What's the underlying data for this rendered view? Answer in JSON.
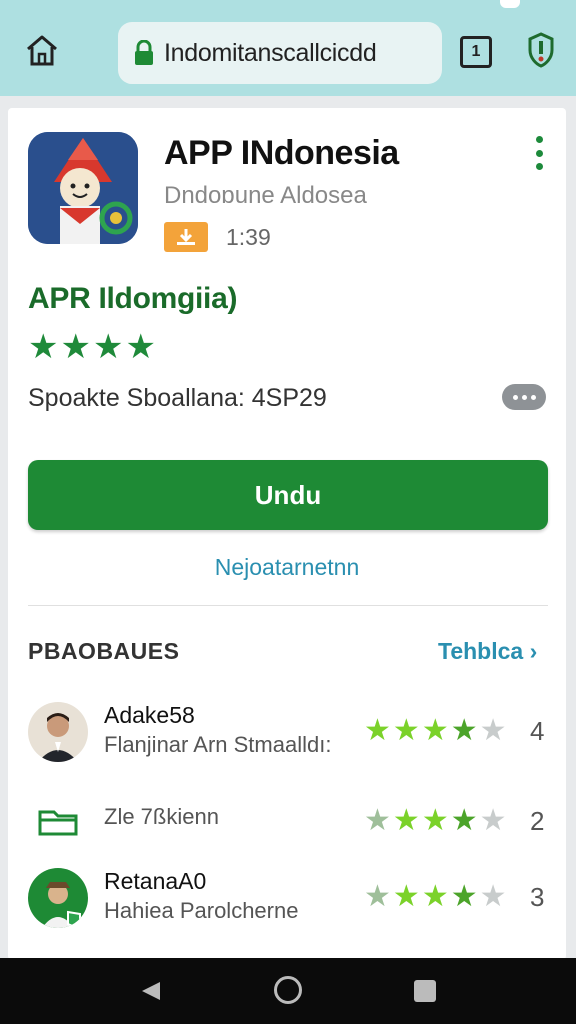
{
  "browser": {
    "url": "Indomitanscallcicdd",
    "tab_count": "1",
    "icons": [
      "home-icon",
      "lock-icon",
      "tabs-icon",
      "alert-shield-icon"
    ]
  },
  "app": {
    "title": "APP INdonesia",
    "subtitle": "Dndoɒune Aldosea",
    "time": "1:39",
    "badge_icon": "download-icon"
  },
  "details": {
    "name": "APR Ildomgiia)",
    "rating_stars": 4,
    "spec": "Spoakte Sboallana: 4SP29",
    "more_icon": "more-horiz-icon"
  },
  "actions": {
    "install_label": "Undu",
    "secondary_link": "Nejoatarnetnn"
  },
  "reviews": {
    "header": "PBAOBAUES",
    "see_all": "Tehblca",
    "items": [
      {
        "name": "Adake58",
        "text": "Flanjinar Arn Stmaalldı:",
        "count": "4",
        "rating": 4.5,
        "avatar": "person-photo"
      },
      {
        "name": "",
        "text": "Zle 7ßkienn",
        "count": "2",
        "rating": 4.5,
        "avatar": "folder-icon"
      },
      {
        "name": "RetanaA0",
        "text": "Hahiea Parolcherne",
        "count": "3",
        "rating": 4.5,
        "avatar": "person-badge"
      }
    ]
  },
  "colors": {
    "topbar": "#aee0e1",
    "brand_green": "#1e8a35",
    "link_blue": "#2a8fb0",
    "badge_orange": "#f3a33a"
  },
  "navbar": {
    "icons": [
      "back-icon",
      "home-circle-icon",
      "recents-icon"
    ]
  }
}
